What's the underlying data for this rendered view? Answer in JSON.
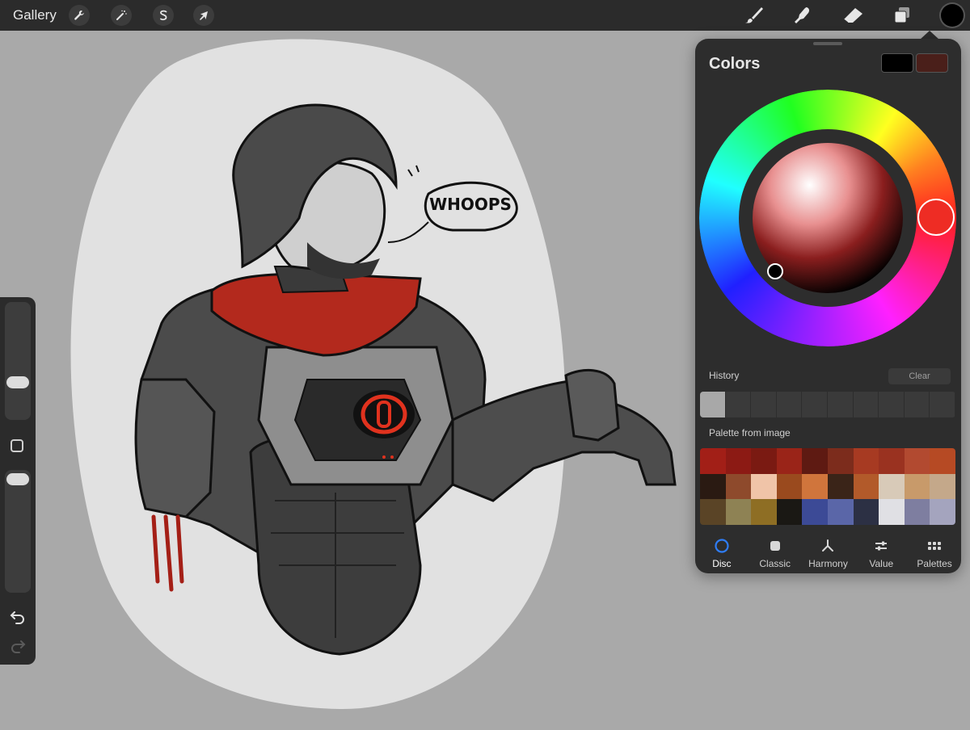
{
  "toolbar": {
    "gallery_label": "Gallery",
    "left_tools": [
      {
        "name": "actions",
        "icon": "wrench-icon"
      },
      {
        "name": "adjustments",
        "icon": "magic-wand-icon"
      },
      {
        "name": "selection",
        "icon": "selection-s-icon"
      },
      {
        "name": "transform",
        "icon": "arrow-cursor-icon"
      }
    ],
    "right_tools": [
      {
        "name": "brush",
        "icon": "brush-icon"
      },
      {
        "name": "smudge",
        "icon": "smudge-finger-icon"
      },
      {
        "name": "eraser",
        "icon": "eraser-icon"
      },
      {
        "name": "layers",
        "icon": "layers-icon"
      }
    ],
    "current_color": "#000000"
  },
  "canvas": {
    "speech_bubble_text": "WHOOPS"
  },
  "sidebar": {
    "size_slider_value": 0.22,
    "opacity_slider_value": 0.12,
    "modify_icon": "square-modify-icon",
    "undo_icon": "undo-icon",
    "redo_icon": "redo-icon"
  },
  "colors_panel": {
    "title": "Colors",
    "primary_swatch": "#000000",
    "secondary_swatch": "#4a1f1a",
    "selected_hue_color": "#ee2c24",
    "history_label": "History",
    "clear_label": "Clear",
    "history": [
      "#a8a8a8"
    ],
    "palette_label": "Palette from image",
    "palette": [
      "#a21f17",
      "#8c1a14",
      "#7a1a12",
      "#9a2418",
      "#5e1a12",
      "#7c2c1c",
      "#a73a22",
      "#9a3220",
      "#b24a30",
      "#b64a24",
      "#2a1a12",
      "#8e4a2c",
      "#f0c4a8",
      "#9a4a1e",
      "#d0753c",
      "#3a2418",
      "#b25a2a",
      "#d8cab8",
      "#c89a6a",
      "#c4a88a",
      "#5a4426",
      "#8e8254",
      "#8e6e24",
      "#1a1814",
      "#3c4a96",
      "#5a66a8",
      "#2c3044",
      "#e0e0e4",
      "#7e7ea0",
      "#a4a4be"
    ],
    "tabs": [
      {
        "label": "Disc",
        "icon": "disc-icon",
        "active": true
      },
      {
        "label": "Classic",
        "icon": "classic-square-icon",
        "active": false
      },
      {
        "label": "Harmony",
        "icon": "harmony-icon",
        "active": false
      },
      {
        "label": "Value",
        "icon": "sliders-icon",
        "active": false
      },
      {
        "label": "Palettes",
        "icon": "palettes-grid-icon",
        "active": false
      }
    ]
  }
}
